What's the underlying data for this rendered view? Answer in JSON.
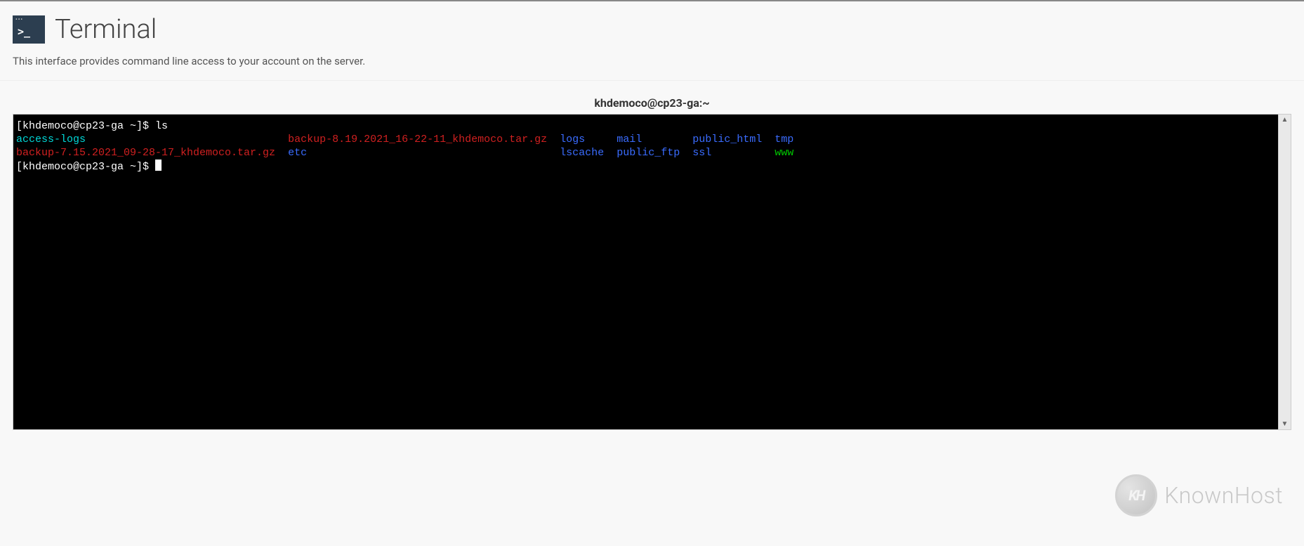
{
  "header": {
    "icon_prompt": ">_",
    "title": "Terminal"
  },
  "description": "This interface provides command line access to your account on the server.",
  "session": "khdemoco@cp23-ga:~",
  "terminal": {
    "prompt1": "[khdemoco@cp23-ga ~]$ ",
    "cmd1": "ls",
    "prompt2": "[khdemoco@cp23-ga ~]$ ",
    "ls": {
      "row1": {
        "c1": "access-logs",
        "c2": "backup-8.19.2021_16-22-11_khdemoco.tar.gz",
        "c3": "logs",
        "c4": "mail",
        "c5": "public_html",
        "c6": "tmp"
      },
      "row2": {
        "c1": "backup-7.15.2021_09-28-17_khdemoco.tar.gz",
        "c2": "etc",
        "c3": "lscache",
        "c4": "public_ftp",
        "c5": "ssl",
        "c6": "www"
      }
    }
  },
  "watermark": {
    "badge": "KH",
    "text": "KnownHost"
  },
  "scroll": {
    "up": "▲",
    "down": "▼"
  }
}
